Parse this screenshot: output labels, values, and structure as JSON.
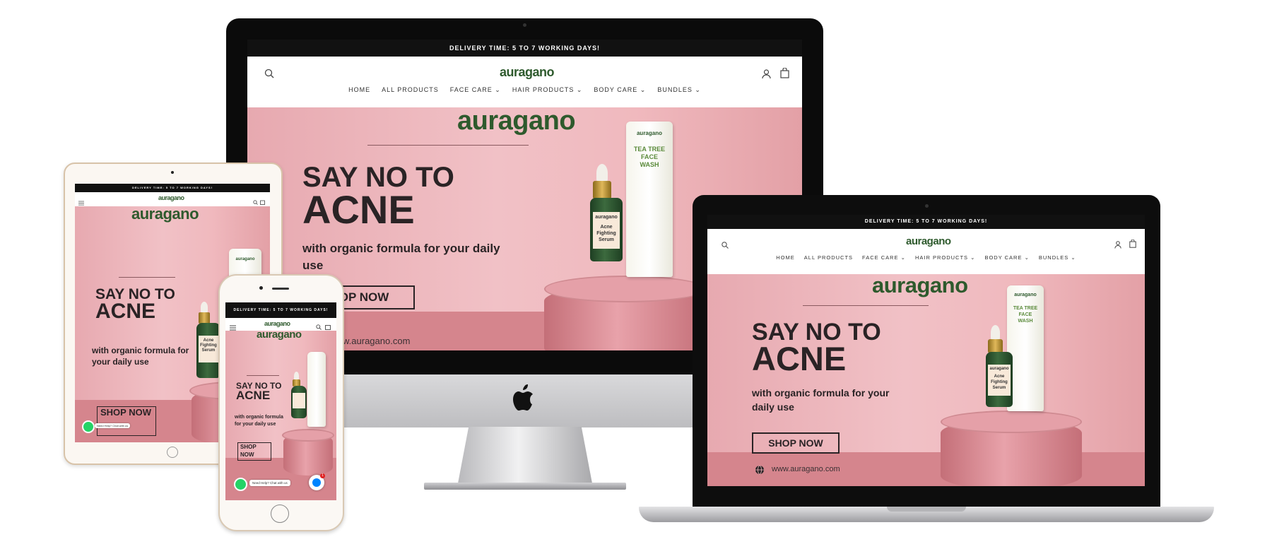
{
  "site": {
    "announcement": "DELIVERY TIME: 5 TO 7 WORKING DAYS!",
    "logo": "auragano",
    "nav": {
      "home": "HOME",
      "all_products": "ALL PRODUCTS",
      "face_care": "FACE CARE",
      "hair_products": "HAIR PRODUCTS",
      "body_care": "BODY CARE",
      "bundles": "BUNDLES",
      "chevron": "⌄"
    },
    "hero": {
      "brand": "auragano",
      "line1": "SAY NO TO",
      "line2": "ACNE",
      "subtitle": "with organic formula for your daily use",
      "cta": "SHOP NOW",
      "cta_desktop_cut": "OP NOW",
      "website": "www.auragano.com",
      "website_desktop_cut": "w.auragano.com"
    },
    "products": {
      "tube_brand": "auragano",
      "tube_name": "TEA TREE FACE WASH",
      "bottle_brand": "auragano",
      "bottle_name": "Acne Fighting Serum"
    },
    "chat": {
      "whatsapp_text": "Need Help? Chat with us",
      "messenger_badge": "1"
    }
  },
  "icons": [
    "search-icon",
    "account-icon",
    "cart-icon",
    "menu-icon",
    "whatsapp-icon",
    "messenger-icon",
    "globe-icon",
    "apple-logo-icon"
  ],
  "colors": {
    "brand_green": "#2e5a2d",
    "hero_pink": "#f1c1c6",
    "announcement_bg": "#111111",
    "whatsapp": "#25d366",
    "messenger": "#0084ff"
  }
}
